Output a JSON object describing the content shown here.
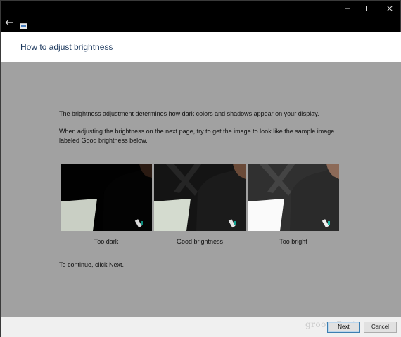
{
  "header": {
    "title": "How to adjust brightness"
  },
  "content": {
    "paragraph1": "The brightness adjustment determines how dark colors and shadows appear on your display.",
    "paragraph2": "When adjusting the brightness on the next page, try to get the image to look like the sample image labeled Good brightness below.",
    "continue_text": "To continue, click Next."
  },
  "samples": [
    {
      "caption": "Too dark"
    },
    {
      "caption": "Good brightness"
    },
    {
      "caption": "Too bright"
    }
  ],
  "footer": {
    "next_label": "Next",
    "cancel_label": "Cancel",
    "watermark": "groovyPost"
  },
  "icons": {
    "back": "back-arrow-icon",
    "app": "display-settings-icon",
    "minimize": "minimize-icon",
    "maximize": "maximize-icon",
    "close": "close-icon"
  }
}
